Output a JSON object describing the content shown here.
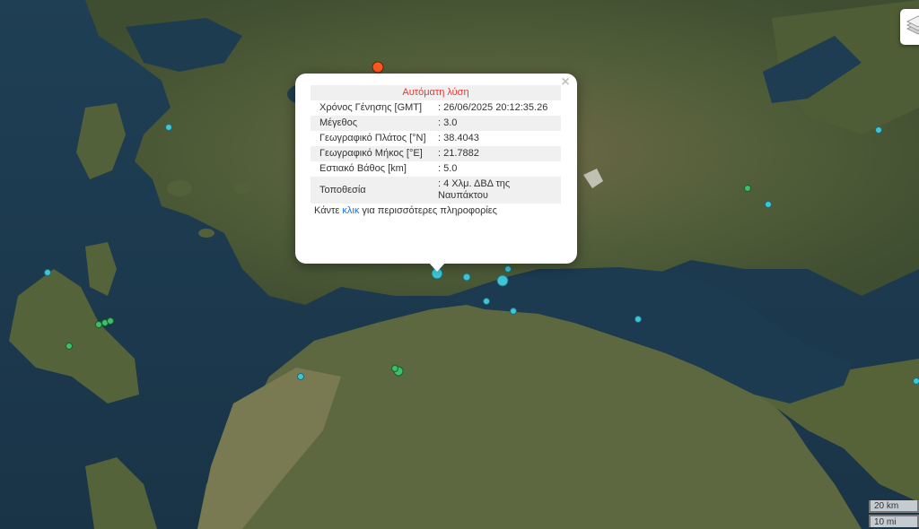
{
  "popup": {
    "title": "Αυτόματη λύση",
    "close_symbol": "×",
    "rows": [
      {
        "label": "Χρόνος Γένησης [GMT]",
        "value": ": 26/06/2025 20:12:35.26"
      },
      {
        "label": "Μέγεθος",
        "value": ": 3.0"
      },
      {
        "label": "Γεωγραφικό Πλάτος [°N]",
        "value": ": 38.4043"
      },
      {
        "label": "Γεωγραφικό Μήκος [°E]",
        "value": ": 21.7882"
      },
      {
        "label": "Εστιακό Βάθος [km]",
        "value": ": 5.0"
      },
      {
        "label": "Τοποθεσία",
        "value": ": 4 Χλμ. ΔΒΔ της Ναυπάκτου"
      }
    ],
    "more_prefix": "Κάντε ",
    "more_link": "κλικ",
    "more_suffix": " για περισσότερες πληροφορίες"
  },
  "scale": {
    "km": "20 km",
    "mi": "10 mi"
  },
  "icons": {
    "layers": "layers-icon",
    "close": "close-icon"
  },
  "colors": {
    "recent_quake": "#ff5a1f",
    "quake_cyan": "#3ec6d6",
    "quake_green": "#3fbf6a",
    "sea": "#1d3b4f",
    "land": "#5a6b42"
  }
}
